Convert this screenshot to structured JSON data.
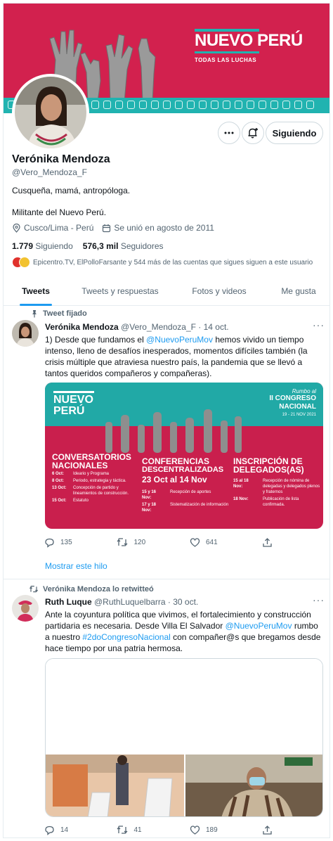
{
  "profile": {
    "banner_logo_word": "NUEVO PERÚ",
    "banner_slogan": "TODAS LAS LUCHAS",
    "name": "Verónika Mendoza",
    "handle": "@Vero_Mendoza_F",
    "bio_line1": "Cusqueña, mamá, antropóloga.",
    "bio_line2": "Militante del Nuevo Perú.",
    "location": "Cusco/Lima - Perú",
    "joined": "Se unió en agosto de 2011",
    "following_count": "1.779",
    "following_label": "Siguiendo",
    "followers_count": "576,3 mil",
    "followers_label": "Seguidores",
    "followed_by": "Epicentro.TV, ElPolloFarsante y 544 más de las cuentas que sigues siguen a este usuario",
    "follow_button": "Siguiendo",
    "more_icon": "more-icon",
    "bell_icon": "bell-plus-icon"
  },
  "tabs": [
    {
      "label": "Tweets",
      "active": true
    },
    {
      "label": "Tweets y respuestas",
      "active": false
    },
    {
      "label": "Fotos y videos",
      "active": false
    },
    {
      "label": "Me gusta",
      "active": false
    }
  ],
  "tweet1": {
    "context": "Tweet fijado",
    "author": "Verónika Mendoza",
    "handle_date": "@Vero_Mendoza_F · 14 oct.",
    "text_a": "1) Desde que fundamos el ",
    "mention": "@NuevoPeruMov",
    "text_b": " hemos vivido un tiempo intenso, lleno de desafíos inesperados, momentos difíciles también (la crisis múltiple que atraviesa nuestro país, la pandemia que se llevó a tantos queridos compañeros y compañeras).",
    "replies": "135",
    "retweets": "120",
    "likes": "641",
    "show_thread": "Mostrar este hilo",
    "poster": {
      "logo": "NUEVO PERÚ",
      "rumbo": "Rumbo al",
      "congreso1": "II CONGRESO",
      "congreso2": "NACIONAL",
      "dates": "19 - 21 NOV 2021",
      "c1_title1": "CONVERSATORIOS",
      "c1_title2": "NACIONALES",
      "c1_rows": [
        {
          "d": "6 Oct:",
          "t": "Ideario y Programa"
        },
        {
          "d": "8 Oct:",
          "t": "Periodo, estrategia y táctica."
        },
        {
          "d": "13 Oct:",
          "t": "Concepción de partido y lineamientos de construcción."
        },
        {
          "d": "15 Oct:",
          "t": "Estatuto"
        }
      ],
      "c2_title1": "CONFERENCIAS",
      "c2_title2": "DESCENTRALIZADAS",
      "c2_dates": "23 Oct al 14 Nov",
      "c2_rows": [
        {
          "d": "15 y 16 Nov:",
          "t": "Recepción de aportes"
        },
        {
          "d": "17 y 18 Nov:",
          "t": "Sistematización de información"
        }
      ],
      "c3_title1": "INSCRIPCIÓN DE",
      "c3_title2": "DELEGADOS(AS)",
      "c3_rows": [
        {
          "d": "15 al 18 Nov:",
          "t": "Recepción de nómina de delegadas y delegados plenos y fraternos"
        },
        {
          "d": "18 Nov:",
          "t": "Publicación de lista confirmada."
        }
      ]
    }
  },
  "tweet2": {
    "context": "Verónika Mendoza lo retwitteó",
    "author": "Ruth Luque",
    "handle_date": "@RuthLuquelbarra · 30 oct.",
    "text_a": "Ante la coyuntura política que vivimos, el fortalecimiento y construcción partidaria es necesaria. Desde Villa El Salvador ",
    "mention": "@NuevoPeruMov",
    "text_b": " rumbo a nuestro ",
    "hashtag": "#2doCongresoNacional",
    "text_c": " con compañer@s que bregamos desde hace tiempo por una patria hermosa.",
    "replies": "14",
    "retweets": "41",
    "likes": "189"
  },
  "colors": {
    "banner_red": "#d2214e",
    "banner_teal": "#21b3b0",
    "twitter_blue": "#1d9bf0",
    "muted_text": "#536471"
  }
}
